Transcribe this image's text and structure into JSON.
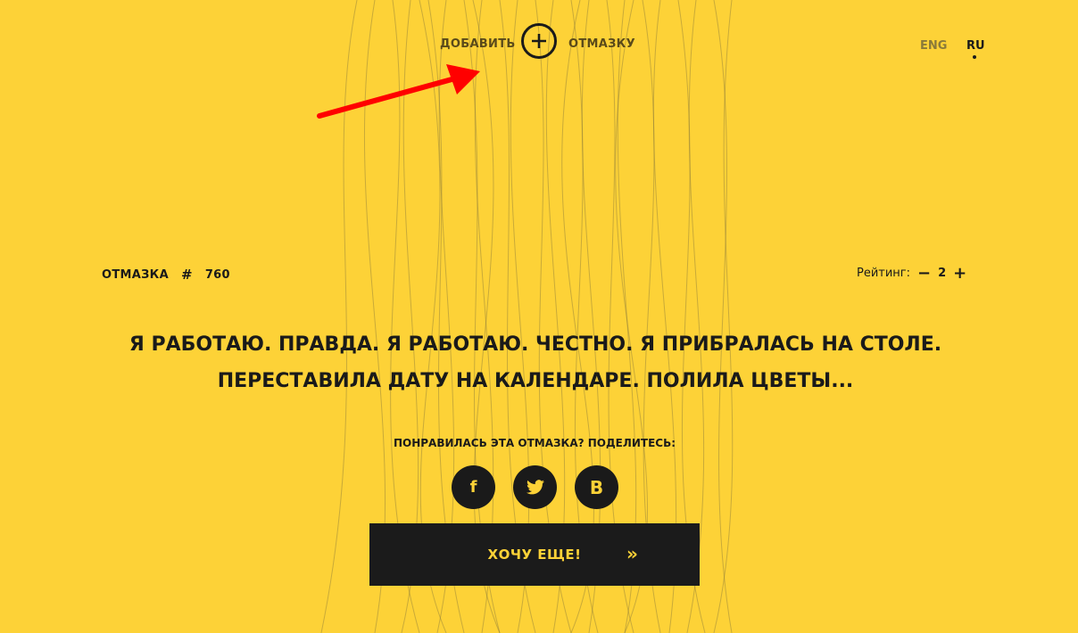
{
  "header": {
    "add_left": "ДОБАВИТЬ",
    "add_right": "ОТМАЗКУ",
    "add_icon": "plus-circle-icon",
    "lang_eng": "ENG",
    "lang_ru": "RU",
    "active_lang": "RU"
  },
  "excuse": {
    "label": "ОТМАЗКА",
    "hash": "#",
    "number": "760",
    "text": "Я РАБОТАЮ. ПРАВДА. Я РАБОТАЮ. ЧЕСТНО. Я ПРИБРАЛАСЬ НА СТОЛЕ. ПЕРЕСТАВИЛА ДАТУ НА КАЛЕНДАРЕ. ПОЛИЛА ЦВЕТЫ..."
  },
  "rating": {
    "label": "Рейтинг:",
    "minus": "−",
    "value": "2",
    "plus": "+"
  },
  "share": {
    "label": "ПОНРАВИЛАСЬ ЭТА ОТМАЗКА? ПОДЕЛИТЕСЬ:",
    "facebook": "f",
    "vk": "B",
    "twitter_icon": "twitter-bird-icon"
  },
  "more_button": {
    "label": "ХОЧУ ЕЩЕ!",
    "arrow": "»"
  },
  "colors": {
    "background": "#FDD237",
    "dark": "#1A1A1A",
    "arrow_annotation": "#FF0000"
  }
}
